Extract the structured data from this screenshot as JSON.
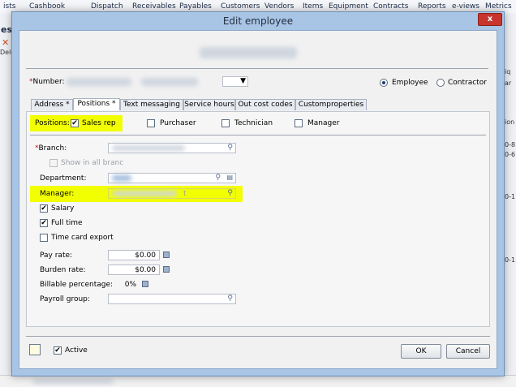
{
  "background_app": {
    "menu": [
      "ists",
      "Cashbook",
      "Dispatch",
      "Receivables",
      "Payables",
      "Customers",
      "Vendors",
      "Items",
      "Equipment",
      "Contracts",
      "Reports",
      "e-views",
      "Metrics"
    ],
    "left_fragments": [
      "es",
      "Dele"
    ],
    "right_fragments": [
      "iq",
      "ar",
      "ion",
      "0-8",
      "0-6",
      "0-1",
      "0-1"
    ]
  },
  "dialog": {
    "title": "Edit employee",
    "close_glyph": "x",
    "number_label": "Number:",
    "employee_option": "Employee",
    "contractor_option": "Contractor",
    "employee_selected": true,
    "tabs": [
      {
        "label": "Address *",
        "active": false
      },
      {
        "label": "Positions *",
        "active": true
      },
      {
        "label": "Text messaging",
        "active": false
      },
      {
        "label": "Service hours",
        "active": false
      },
      {
        "label": "Out cost codes",
        "active": false
      },
      {
        "label": "Customproperties",
        "active": false
      }
    ],
    "positions": {
      "label": "Positions:",
      "options": [
        {
          "label": "Sales rep",
          "checked": true
        },
        {
          "label": "Purchaser",
          "checked": false
        },
        {
          "label": "Technician",
          "checked": false
        },
        {
          "label": "Manager",
          "checked": false
        }
      ]
    },
    "form": {
      "branch_label": "Branch:",
      "show_all_branches_label": "Show in all branc",
      "department_label": "Department:",
      "manager_label": "Manager:",
      "manager_value_fragment": "t",
      "salary_label": "Salary",
      "salary_checked": true,
      "full_time_label": "Full time",
      "full_time_checked": true,
      "time_card_export_label": "Time card export",
      "time_card_export_checked": false,
      "pay_rate_label": "Pay rate:",
      "pay_rate_value": "$0.00",
      "burden_rate_label": "Burden rate:",
      "burden_rate_value": "$0.00",
      "billable_percentage_label": "Billable percentage:",
      "billable_percentage_value": "0%",
      "payroll_group_label": "Payroll group:"
    },
    "footer": {
      "active_label": "Active",
      "active_checked": true,
      "ok_label": "OK",
      "cancel_label": "Cancel"
    },
    "check_glyph": "✔",
    "dropdown_glyph": "▼",
    "search_glyph": "⚲",
    "colors": {
      "highlight": "#f2ff00",
      "title_bar": "#a9c5e6",
      "close_button": "#c7352c",
      "required": "#d01010"
    }
  }
}
